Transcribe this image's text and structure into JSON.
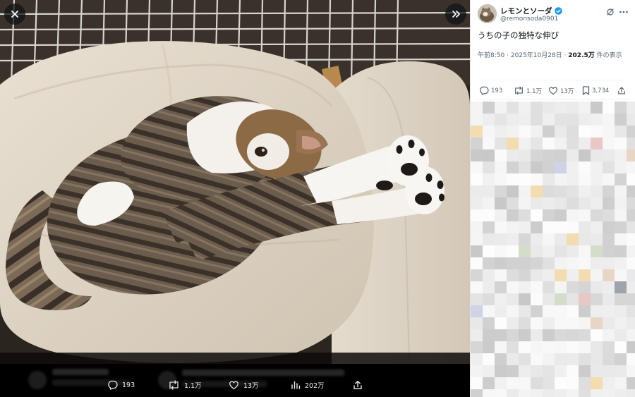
{
  "viewer": {
    "close_icon": "close-icon",
    "expand_icon": "chevrons-right-icon",
    "actions": {
      "reply_count": "193",
      "repost_count": "1.1万",
      "like_count": "13万",
      "views_count": "202万"
    }
  },
  "author": {
    "display_name": "レモンとソーダ",
    "handle": "@remonsoda0901",
    "verified": true,
    "verified_color": "#1d9bf0"
  },
  "post": {
    "text": "うちの子の独特な伸び",
    "time": "午前8:50",
    "sep": "·",
    "date": "2025年10月28日",
    "views_number": "202.5万",
    "views_suffix": "件の表示"
  },
  "stats": {
    "replies": "193",
    "reposts": "1.1万",
    "likes": "13万",
    "bookmarks": "3,734"
  },
  "colors": {
    "accent": "#1d9bf0",
    "text_primary": "#0f1419",
    "text_secondary": "#536471"
  }
}
